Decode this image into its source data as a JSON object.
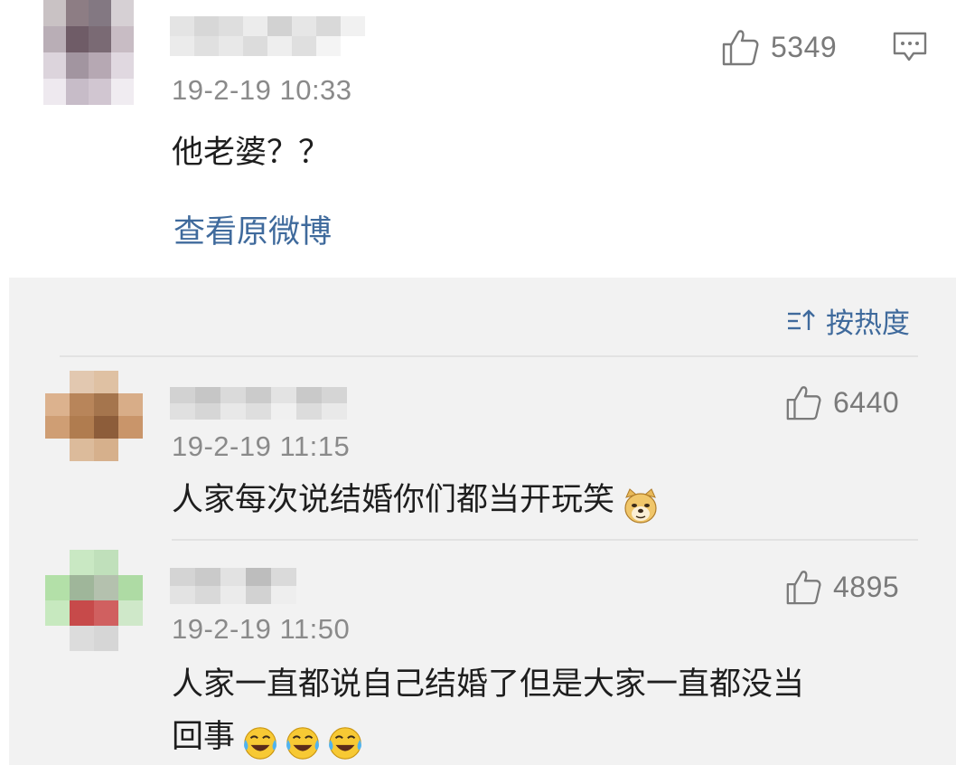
{
  "main_comment": {
    "timestamp": "19-2-19 10:33",
    "text": "他老婆？？",
    "likes": "5349",
    "view_original_label": "查看原微博"
  },
  "replies_panel": {
    "sort_label": "按热度",
    "replies": [
      {
        "timestamp": "19-2-19 11:15",
        "text": "人家每次说结婚你们都当开玩笑",
        "emojis": [
          "doge-emoji"
        ],
        "likes": "6440"
      },
      {
        "timestamp": "19-2-19 11:50",
        "text_line1": "人家一直都说自己结婚了但是大家一直都没当",
        "text_line2": "回事",
        "emojis": [
          "laugh-cry-emoji",
          "laugh-cry-emoji",
          "laugh-cry-emoji"
        ],
        "likes": "4895"
      }
    ]
  },
  "colors": {
    "link_blue": "#3f6a9c",
    "panel_bg": "#f2f2f2",
    "meta_gray": "#8a8a8a"
  }
}
